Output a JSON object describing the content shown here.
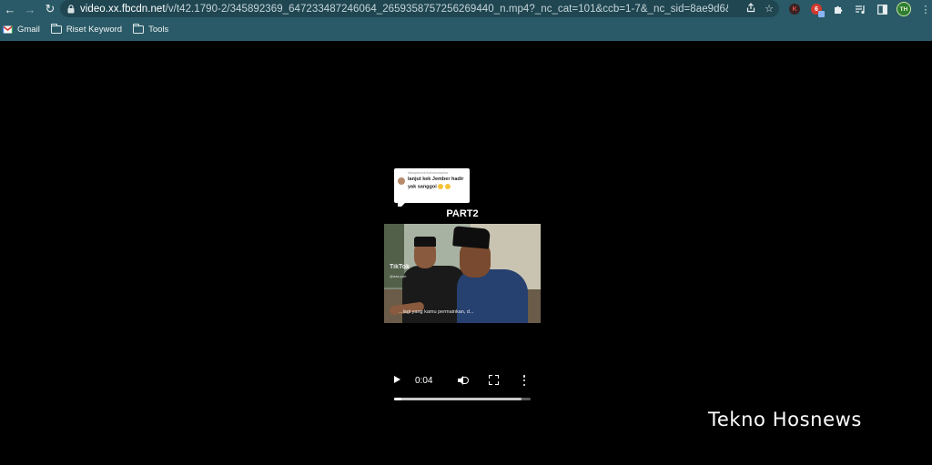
{
  "browser": {
    "url_host": "video.xx.fbcdn.net",
    "url_path": "/v/t42.1790-2/345892369_647233487246064_2659358757256269440_n.mp4?_nc_cat=101&ccb=1-7&_nc_sid=8ae9d6&_nc_...",
    "extensions": {
      "k_label": "K",
      "red_label": "6",
      "profile_initials": "TH"
    },
    "bookmarks": [
      {
        "label": "Gmail",
        "icon": "gmail-icon"
      },
      {
        "label": "Riset Keyword",
        "icon": "folder-icon"
      },
      {
        "label": "Tools",
        "icon": "folder-icon"
      }
    ]
  },
  "video": {
    "comment_user": "fatasyamerdzharhanzsaptsa",
    "comment_text": "lanjut kek Jember hadir yak sanggoi",
    "part_title": "PART2",
    "watermark": "TikTok",
    "watermark_handle": "@aas.part",
    "subtitle": "...lagi yang kamu permainkan, d...",
    "current_time": "0:04",
    "buffered_fraction": 0.93,
    "played_fraction": 0.05
  },
  "overlay": {
    "brand_text": "Tekno Hosnews"
  },
  "colors": {
    "chrome_bg": "#2a5a67",
    "omnibox_bg": "#1f4651",
    "page_bg": "#000000"
  }
}
